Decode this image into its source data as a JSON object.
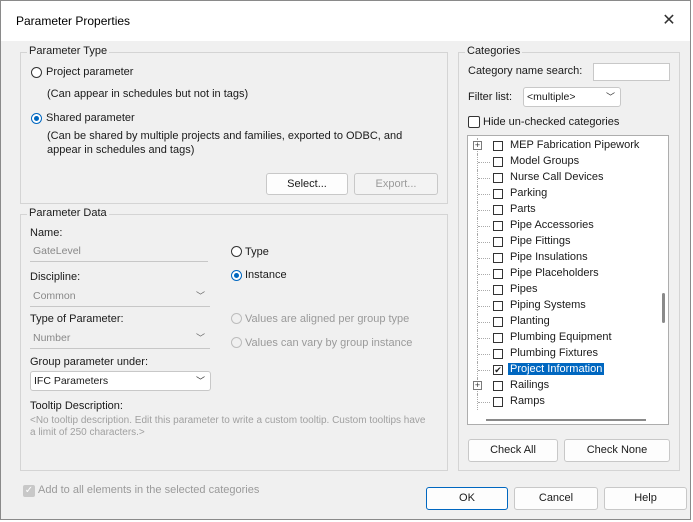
{
  "window": {
    "title": "Parameter Properties"
  },
  "parameter_type": {
    "label": "Parameter Type",
    "project_label": "Project parameter",
    "project_desc": "(Can appear in schedules but not in tags)",
    "shared_label": "Shared parameter",
    "shared_desc_line1": "(Can be shared by multiple projects and families, exported to ODBC, and",
    "shared_desc_line2": "appear in schedules and tags)",
    "selected": "shared",
    "select_button": "Select...",
    "export_button": "Export..."
  },
  "parameter_data": {
    "label": "Parameter Data",
    "name_label": "Name:",
    "name_value": "GateLevel",
    "discipline_label": "Discipline:",
    "discipline_value": "Common",
    "type_label": "Type of Parameter:",
    "type_value": "Number",
    "group_label": "Group parameter under:",
    "group_value": "IFC Parameters",
    "type_radio": "Type",
    "instance_radio": "Instance",
    "instance_selected": true,
    "aligned_label": "Values are aligned per group type",
    "vary_label": "Values can vary by group instance",
    "tooltip_label": "Tooltip Description:",
    "tooltip_line1": "<No tooltip description. Edit this parameter to write a custom tooltip. Custom tooltips have",
    "tooltip_line2": "a limit of 250 characters.>"
  },
  "categories": {
    "label": "Categories",
    "search_label": "Category name search:",
    "search_value": "",
    "filter_label": "Filter list:",
    "filter_value": "<multiple>",
    "hide_label": "Hide un-checked categories",
    "items": [
      {
        "label": "MEP Fabrication Pipework",
        "expandable": true,
        "checked": false,
        "selected": false
      },
      {
        "label": "Model Groups",
        "expandable": false,
        "checked": false,
        "selected": false
      },
      {
        "label": "Nurse Call Devices",
        "expandable": false,
        "checked": false,
        "selected": false
      },
      {
        "label": "Parking",
        "expandable": false,
        "checked": false,
        "selected": false
      },
      {
        "label": "Parts",
        "expandable": false,
        "checked": false,
        "selected": false
      },
      {
        "label": "Pipe Accessories",
        "expandable": false,
        "checked": false,
        "selected": false
      },
      {
        "label": "Pipe Fittings",
        "expandable": false,
        "checked": false,
        "selected": false
      },
      {
        "label": "Pipe Insulations",
        "expandable": false,
        "checked": false,
        "selected": false
      },
      {
        "label": "Pipe Placeholders",
        "expandable": false,
        "checked": false,
        "selected": false
      },
      {
        "label": "Pipes",
        "expandable": false,
        "checked": false,
        "selected": false
      },
      {
        "label": "Piping Systems",
        "expandable": false,
        "checked": false,
        "selected": false
      },
      {
        "label": "Planting",
        "expandable": false,
        "checked": false,
        "selected": false
      },
      {
        "label": "Plumbing Equipment",
        "expandable": false,
        "checked": false,
        "selected": false
      },
      {
        "label": "Plumbing Fixtures",
        "expandable": false,
        "checked": false,
        "selected": false
      },
      {
        "label": "Project Information",
        "expandable": false,
        "checked": true,
        "selected": true
      },
      {
        "label": "Railings",
        "expandable": true,
        "checked": false,
        "selected": false
      },
      {
        "label": "Ramps",
        "expandable": false,
        "checked": false,
        "selected": false
      }
    ],
    "check_all": "Check All",
    "check_none": "Check None"
  },
  "footer": {
    "add_all_label": "Add to all elements in the selected categories",
    "ok": "OK",
    "cancel": "Cancel",
    "help": "Help"
  },
  "colors": {
    "accent": "#0067c0",
    "dialog_bg": "#f0f0f0"
  }
}
